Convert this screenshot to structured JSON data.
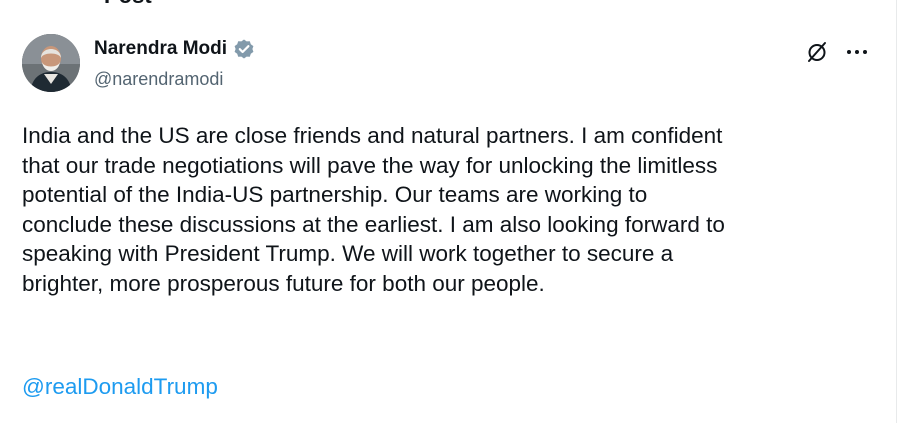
{
  "header": {
    "title": "Post"
  },
  "post": {
    "author": {
      "display_name": "Narendra Modi",
      "handle": "@narendramodi",
      "verified": true,
      "verified_color": "#829aab"
    },
    "actions": {
      "grok_icon": "grok-slash-icon",
      "more_icon": "more-dots-icon"
    },
    "body": "India and the US are close friends and natural partners. I am confident\nthat our trade negotiations will pave the way for unlocking the limitless\npotential of the India-US partnership. Our teams are working to\nconclude these discussions at the earliest. I am also looking forward to\nspeaking with President Trump. We will work together to secure a\nbrighter, more prosperous future for both our people.",
    "mention": "@realDonaldTrump",
    "link_color": "#1d9bf0"
  }
}
